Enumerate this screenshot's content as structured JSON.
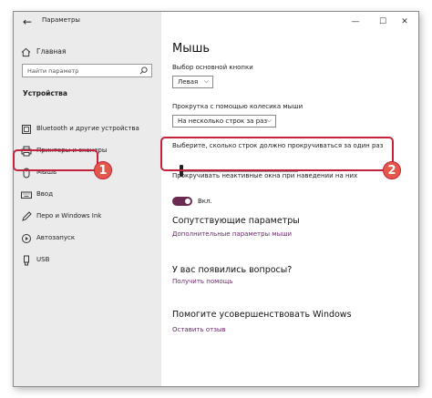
{
  "window": {
    "title": "Параметры",
    "back_glyph": "←",
    "minimize_glyph": "—",
    "maximize_glyph": "☐",
    "close_glyph": "✕"
  },
  "sidebar": {
    "home_label": "Главная",
    "search_placeholder": "Найти параметр",
    "section_title": "Устройства",
    "items": [
      {
        "label": "Bluetooth и другие устройства",
        "icon": "bluetooth-icon"
      },
      {
        "label": "Принтеры и сканеры",
        "icon": "printer-icon"
      },
      {
        "label": "Мышь",
        "icon": "mouse-icon",
        "selected": true
      },
      {
        "label": "Ввод",
        "icon": "keyboard-icon"
      },
      {
        "label": "Перо и Windows Ink",
        "icon": "pen-icon"
      },
      {
        "label": "Автозапуск",
        "icon": "autoplay-icon"
      },
      {
        "label": "USB",
        "icon": "usb-icon"
      }
    ]
  },
  "main": {
    "title": "Мышь",
    "primary_button_label": "Выбор основной кнопки",
    "primary_button_value": "Левая",
    "scroll_label": "Прокрутка с помощью колесика мыши",
    "scroll_value": "На несколько строк за раз",
    "lines_label": "Выберите, сколько строк должно прокручиваться за один раз",
    "lines_slider_fraction": 0.0,
    "inactive_scroll_label": "Прокручивать неактивные окна при наведении на них",
    "inactive_scroll_state": "Вкл.",
    "related_title": "Сопутствующие параметры",
    "related_link": "Дополнительные параметры мыши",
    "questions_title": "У вас появились вопросы?",
    "questions_link": "Получить помощь",
    "improve_title": "Помогите усовершенствовать Windows",
    "improve_link": "Оставить отзыв"
  },
  "annotations": {
    "badge_1": "1",
    "badge_2": "2"
  },
  "colors": {
    "callout": "#c4223c",
    "badge_fill": "#e2584a",
    "accent_toggle": "#6b2a4f",
    "link": "#6a2a6a"
  }
}
